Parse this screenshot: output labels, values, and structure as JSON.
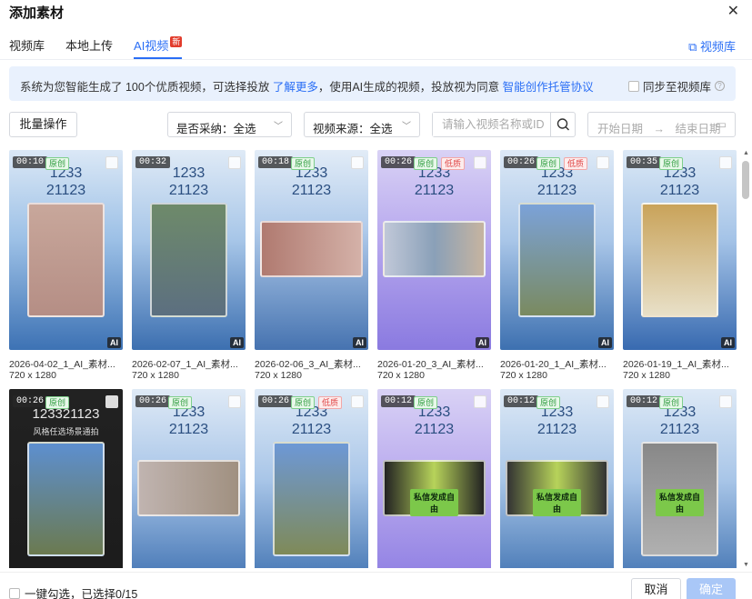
{
  "dialog": {
    "title": "添加素材",
    "close_icon": "close-icon"
  },
  "tabs": [
    {
      "label": "视频库",
      "active": false
    },
    {
      "label": "本地上传",
      "active": false
    },
    {
      "label": "AI视频",
      "active": true,
      "badge": "新"
    }
  ],
  "library_link": "视频库",
  "banner": {
    "text1": "系统为您智能生成了 100个优质视频，可选择投放",
    "link1": "了解更多",
    "text2": "，使用AI生成的视频，投放视为同意",
    "link2": "智能创作托管协议",
    "sync_label": "同步至视频库"
  },
  "toolbar": {
    "batch_label": "批量操作",
    "adopted_select": "是否采纳：全选",
    "source_select": "视频来源：全选",
    "search_placeholder": "请输入视频名称或ID",
    "date_start": "开始日期",
    "date_arrow": "→",
    "date_end": "结束日期"
  },
  "videos": [
    {
      "duration": "00:10",
      "tags": [
        "原创"
      ],
      "title": "1233\n21123",
      "name": "2026-04-02_1_AI_素材...",
      "resolution": "720 x 1280",
      "ai": "AI"
    },
    {
      "duration": "00:32",
      "tags": [],
      "title": "1233\n21123",
      "name": "2026-02-07_1_AI_素材...",
      "resolution": "720 x 1280",
      "ai": "AI"
    },
    {
      "duration": "00:18",
      "tags": [
        "原创"
      ],
      "title": "1233\n21123",
      "name": "2026-02-06_3_AI_素材...",
      "resolution": "720 x 1280",
      "ai": "AI"
    },
    {
      "duration": "00:26",
      "tags": [
        "原创",
        "低质"
      ],
      "title": "1233\n21123",
      "name": "2026-01-20_3_AI_素材...",
      "resolution": "720 x 1280",
      "ai": "AI"
    },
    {
      "duration": "00:26",
      "tags": [
        "原创",
        "低质"
      ],
      "title": "1233\n21123",
      "name": "2026-01-20_1_AI_素材...",
      "resolution": "720 x 1280",
      "ai": "AI"
    },
    {
      "duration": "00:35",
      "tags": [
        "原创"
      ],
      "title": "1233\n21123",
      "name": "2026-01-19_1_AI_素材...",
      "resolution": "720 x 1280",
      "ai": "AI"
    },
    {
      "duration": "00:26",
      "tags": [
        "原创"
      ],
      "title": "123321123",
      "subtitle": "风格任选场景通拍",
      "name": "",
      "resolution": "",
      "ai": ""
    },
    {
      "duration": "00:26",
      "tags": [
        "原创"
      ],
      "title": "1233\n21123",
      "name": "",
      "resolution": "",
      "ai": ""
    },
    {
      "duration": "00:26",
      "tags": [
        "原创",
        "低质"
      ],
      "title": "1233\n21123",
      "name": "",
      "resolution": "",
      "ai": ""
    },
    {
      "duration": "00:12",
      "tags": [
        "原创"
      ],
      "title": "1233\n21123",
      "overlay": "私信发成自\n由",
      "name": "",
      "resolution": "",
      "ai": ""
    },
    {
      "duration": "00:12",
      "tags": [
        "原创"
      ],
      "title": "1233\n21123",
      "overlay": "私信发成自\n由",
      "name": "",
      "resolution": "",
      "ai": ""
    },
    {
      "duration": "00:12",
      "tags": [
        "原创"
      ],
      "title": "1233\n21123",
      "overlay": "私信发成自\n由",
      "name": "",
      "resolution": "",
      "ai": ""
    }
  ],
  "footer": {
    "select_all": "一键勾选，已选择0/15",
    "cancel": "取消",
    "confirm": "确定"
  },
  "colors": {
    "accent": "#2a6ef5",
    "banner_bg": "#e9f1fd",
    "confirm_disabled": "#a9c7f7"
  }
}
